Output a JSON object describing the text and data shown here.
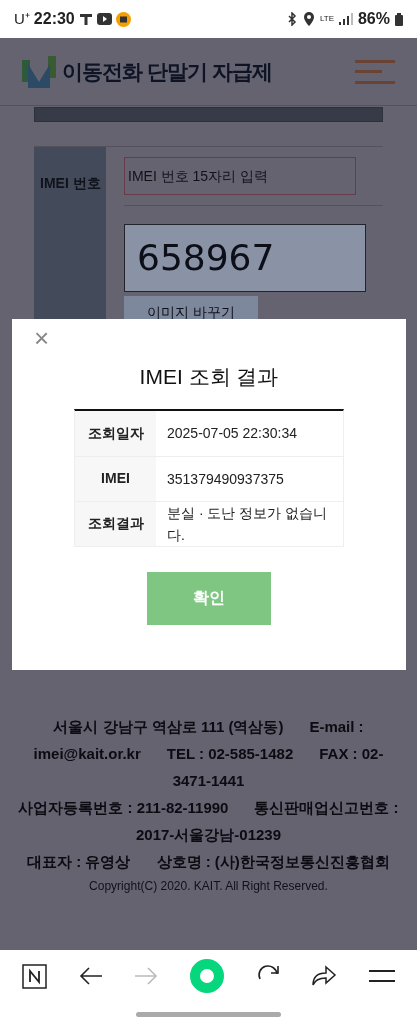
{
  "status_bar": {
    "carrier": "U⁺",
    "time": "22:30",
    "battery": "86%",
    "network": "LTE"
  },
  "header": {
    "title": "이동전화 단말기 자급제"
  },
  "form": {
    "label": "IMEI 번호",
    "placeholder": "IMEI 번호 15자리 입력",
    "captcha_text": "658967",
    "captcha_button": "이미지 바꾸기"
  },
  "modal": {
    "title": "IMEI 조회 결과",
    "close": "×",
    "rows": [
      {
        "label": "조회일자",
        "value": "2025-07-05 22:30:34"
      },
      {
        "label": "IMEI",
        "value": "351379490937375"
      },
      {
        "label": "조회결과",
        "value": "분실 · 도난 정보가 없습니다."
      }
    ],
    "confirm": "확인"
  },
  "footer": {
    "lines": [
      [
        "서울시 강남구 역삼로 111 (역삼동)",
        "E-mail :"
      ],
      [
        "imei@kait.or.kr",
        "TEL : 02-585-1482",
        "FAX : 02-"
      ],
      [
        "3471-1441"
      ],
      [
        "사업자등록번호 : 211-82-11990",
        "통신판매업신고번호 :"
      ],
      [
        "2017-서울강남-01239"
      ],
      [
        "대표자 : 유영상",
        "상호명 : (사)한국정보통신진흥협회"
      ]
    ],
    "copyright": "Copyright(C) 2020. KAIT. All Right Reserved."
  },
  "browser_bar": {
    "forward_disabled": true
  }
}
